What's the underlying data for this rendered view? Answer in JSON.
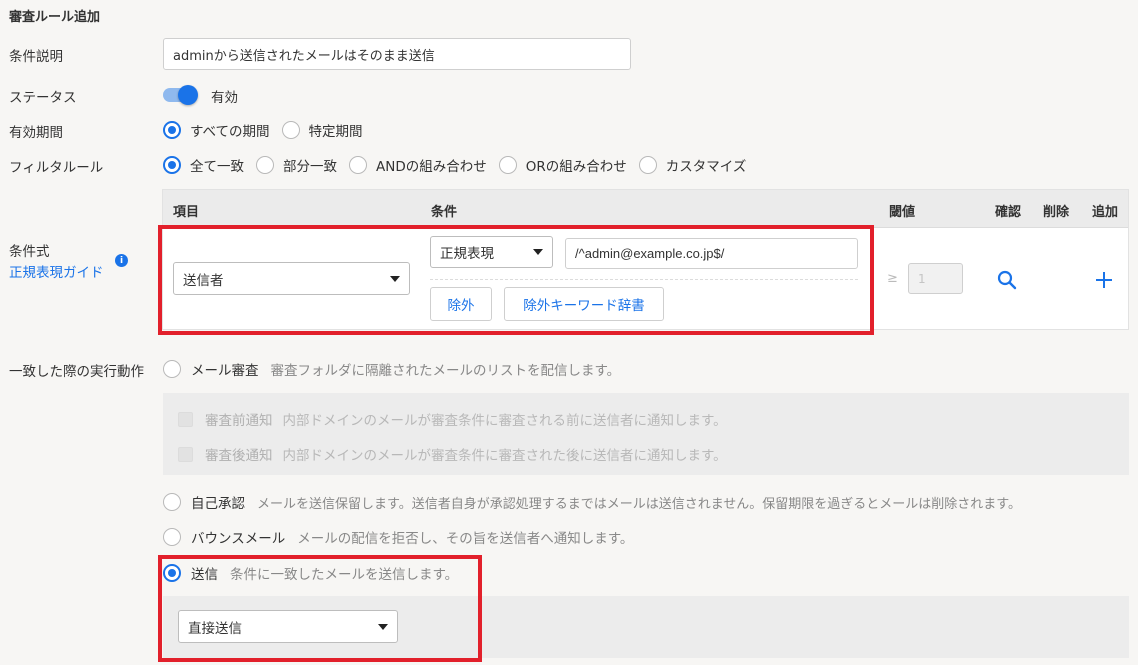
{
  "page": {
    "title": "審査ルール追加"
  },
  "fields": {
    "description": {
      "label": "条件説明",
      "value": "adminから送信されたメールはそのまま送信"
    },
    "status": {
      "label": "ステータス",
      "value": "有効"
    },
    "period": {
      "label": "有効期間",
      "options": [
        "すべての期間",
        "特定期間"
      ],
      "selected": "すべての期間"
    },
    "filter_rule": {
      "label": "フィルタルール",
      "options": [
        "全て一致",
        "部分一致",
        "ANDの組み合わせ",
        "ORの組み合わせ",
        "カスタマイズ"
      ],
      "selected": "全て一致"
    },
    "expression": {
      "label": "条件式",
      "guide_link": "正規表現ガイド"
    }
  },
  "table": {
    "headers": {
      "item": "項目",
      "condition": "条件",
      "threshold": "閾値",
      "confirm": "確認",
      "delete": "削除",
      "add": "追加"
    },
    "row": {
      "item": "送信者",
      "condition_type": "正規表現",
      "pattern": "/^admin@example.co.jp$/",
      "exclude_button": "除外",
      "exclude_dict_button": "除外キーワード辞書",
      "threshold_symbol": "≥",
      "threshold_placeholder": "1"
    }
  },
  "actions": {
    "label": "一致した際の実行動作",
    "selected": "送信",
    "items": [
      {
        "name": "メール審査",
        "desc": "審査フォルダに隔離されたメールのリストを配信します。"
      },
      {
        "name": "自己承認",
        "desc": "メールを送信保留します。送信者自身が承認処理するまではメールは送信されません。保留期限を過ぎるとメールは削除されます。"
      },
      {
        "name": "バウンスメール",
        "desc": "メールの配信を拒否し、その旨を送信者へ通知します。"
      },
      {
        "name": "送信",
        "desc": "条件に一致したメールを送信します。"
      }
    ],
    "review_options": [
      {
        "name": "審査前通知",
        "desc": "内部ドメインのメールが審査条件に審査される前に送信者に通知します。"
      },
      {
        "name": "審査後通知",
        "desc": "内部ドメインのメールが審査条件に審査された後に送信者に通知します。"
      }
    ],
    "send_method": "直接送信"
  },
  "colors": {
    "accent": "#1a73e8",
    "highlight_box": "#e2202b"
  }
}
